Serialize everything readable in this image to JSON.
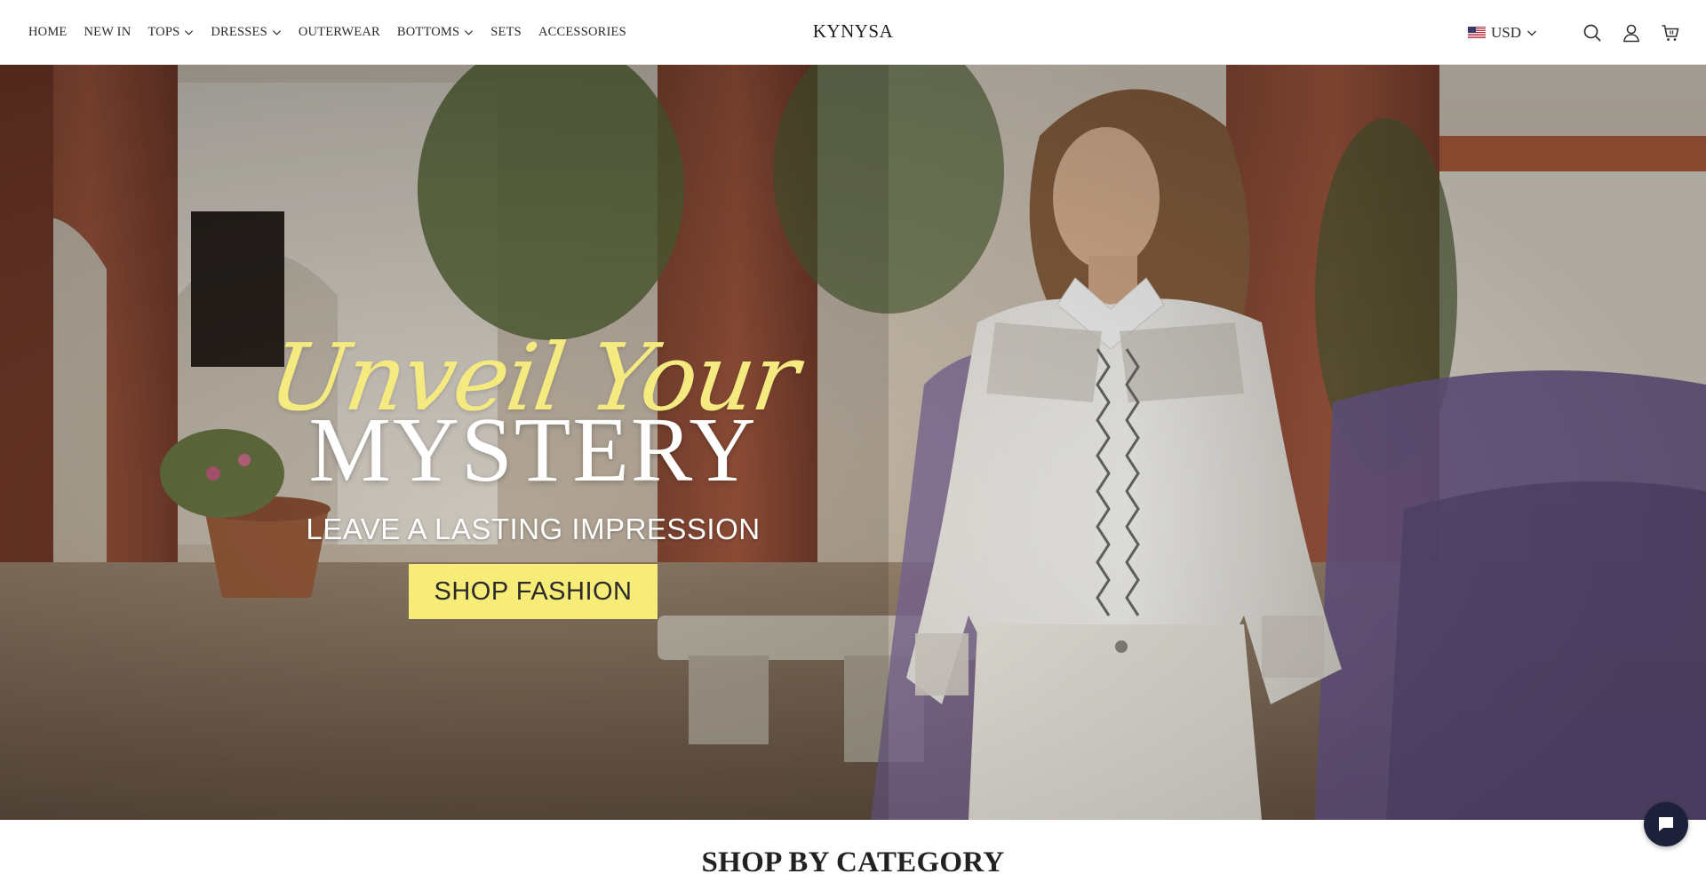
{
  "header": {
    "logo": "KYNYSA",
    "nav": [
      {
        "label": "HOME",
        "dropdown": false
      },
      {
        "label": "NEW IN",
        "dropdown": false
      },
      {
        "label": "TOPS",
        "dropdown": true
      },
      {
        "label": "DRESSES",
        "dropdown": true
      },
      {
        "label": "OUTERWEAR",
        "dropdown": false
      },
      {
        "label": "BOTTOMS",
        "dropdown": true
      },
      {
        "label": "SETS",
        "dropdown": false
      },
      {
        "label": "ACCESSORIES",
        "dropdown": false
      }
    ],
    "currency": "USD",
    "icons": [
      "search-icon",
      "account-icon",
      "cart-icon"
    ]
  },
  "hero": {
    "script_line": "Unveil Your",
    "headline": "MYSTERY",
    "tagline": "LEAVE A LASTING IMPRESSION",
    "cta_label": "SHOP FASHION"
  },
  "sections": {
    "category_title": "SHOP BY CATEGORY"
  },
  "colors": {
    "accent_yellow": "#f8ec79",
    "script_yellow": "#f4ea80",
    "chat_bubble": "#1c2038"
  }
}
